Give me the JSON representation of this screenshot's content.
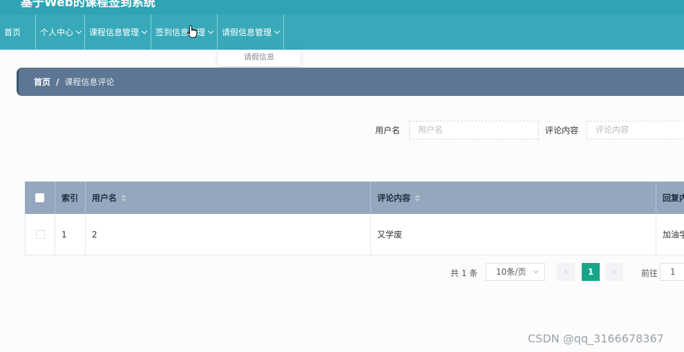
{
  "app": {
    "system_title": "基于Web的课程签到系统"
  },
  "nav": {
    "items": [
      {
        "label": "首页",
        "has_dropdown": false
      },
      {
        "label": "个人中心",
        "has_dropdown": true
      },
      {
        "label": "课程信息管理",
        "has_dropdown": true
      },
      {
        "label": "签到信息管理",
        "has_dropdown": true
      },
      {
        "label": "请假信息管理",
        "has_dropdown": true
      }
    ],
    "dropdown_item": "请假信息"
  },
  "breadcrumb": {
    "home": "首页",
    "separator": "/",
    "current": "课程信息评论"
  },
  "search": {
    "username_label": "用户名",
    "username_placeholder": "用户名",
    "comment_label": "评论内容",
    "comment_placeholder": "评论内容"
  },
  "table": {
    "columns": [
      "索引",
      "用户名",
      "评论内容",
      "回复内容"
    ],
    "rows": [
      {
        "index": "1",
        "username": "2",
        "comment": "又学废",
        "reply": "加油学"
      }
    ]
  },
  "pagination": {
    "total_text": "共 1 条",
    "page_size": "10条/页",
    "prev": "‹",
    "current_page": "1",
    "next": "›",
    "goto_label": "前往",
    "goto_value": "1"
  },
  "watermark": "CSDN @qq_3166678367",
  "colors": {
    "topbar": "#2fa4b5",
    "navbar": "#38a9b9",
    "breadcrumb": "#5d7693",
    "table_header": "#94a7be",
    "active_page": "#17a589"
  }
}
